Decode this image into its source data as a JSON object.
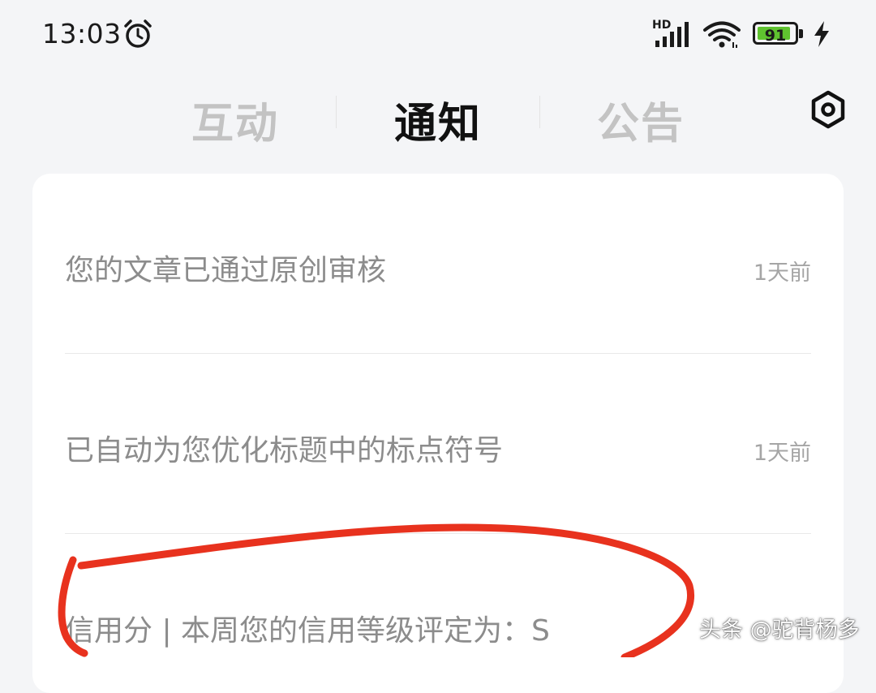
{
  "status_bar": {
    "time": "13:03",
    "network_label": "HD",
    "battery_level": "91",
    "battery_percent": 91
  },
  "tabs": [
    {
      "label": "互动",
      "active": false
    },
    {
      "label": "通知",
      "active": true
    },
    {
      "label": "公告",
      "active": false
    }
  ],
  "notifications": [
    {
      "title": "您的文章已通过原创审核",
      "time": "1天前"
    },
    {
      "title": "已自动为您优化标题中的标点符号",
      "time": "1天前"
    },
    {
      "title": "信用分 | 本周您的信用等级评定为：S",
      "time": ""
    }
  ],
  "watermark": "头条 @驼背杨多",
  "colors": {
    "accent_active_tab": "#111111",
    "inactive_tab": "#c3c3c3",
    "battery_fill": "#5fc32f",
    "annotation_red": "#e8321e"
  },
  "icons": [
    "alarm-icon",
    "signal-icon",
    "wifi-icon",
    "charging-icon",
    "settings-icon"
  ]
}
